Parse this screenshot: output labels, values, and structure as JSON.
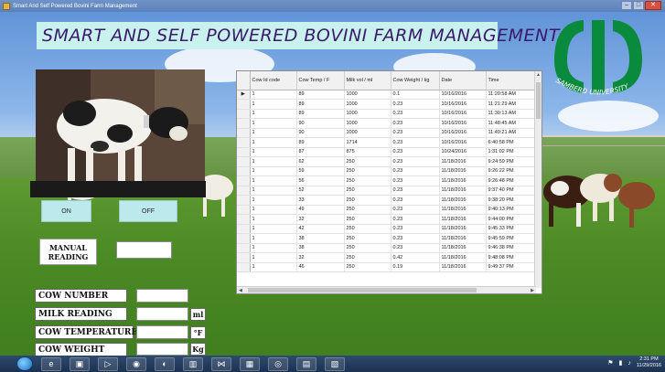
{
  "window": {
    "title": "Smart And Self Powered Bovini Farm Management",
    "minimize": "–",
    "maximize": "□",
    "close": "✕"
  },
  "heading": "SMART AND SELF POWERED BOVINI FARM MANAGEMENT",
  "logo": {
    "text": "SAMBERD UNIVERSITY",
    "icon": "university-logo"
  },
  "controls": {
    "on_label": "ON",
    "off_label": "OFF",
    "manual_reading_line1": "MANUAL",
    "manual_reading_line2": "READING",
    "manual_reading_value": ""
  },
  "fields": {
    "cow_number": {
      "label": "COW NUMBER",
      "value": ""
    },
    "milk_reading": {
      "label": "MILK READING",
      "value": "",
      "unit": "ml"
    },
    "cow_temperature": {
      "label": "COW TEMPERATURE",
      "value": "",
      "unit": "°F"
    },
    "cow_weight": {
      "label": "COW WEIGHT",
      "value": "",
      "unit": "Kg"
    }
  },
  "grid": {
    "columns": [
      "Cow Id code",
      "Cow Temp / F",
      "Milk vol / ml",
      "Cow Weight / kg",
      "Date",
      "Time"
    ],
    "rows": [
      [
        "1",
        "89",
        "1000",
        "0.1",
        "10/16/2016",
        "11:20:58 AM"
      ],
      [
        "1",
        "89",
        "1000",
        "0.23",
        "10/16/2016",
        "11:21:29 AM"
      ],
      [
        "1",
        "89",
        "1000",
        "0.23",
        "10/16/2016",
        "11:30:13 AM"
      ],
      [
        "1",
        "90",
        "1000",
        "0.23",
        "10/16/2016",
        "11:48:45 AM"
      ],
      [
        "1",
        "90",
        "1000",
        "0.23",
        "10/16/2016",
        "11:49:21 AM"
      ],
      [
        "1",
        "89",
        "1714",
        "0.23",
        "10/16/2016",
        "6:40:58 PM"
      ],
      [
        "1",
        "87",
        "875",
        "0.23",
        "10/24/2016",
        "1:31:02 PM"
      ],
      [
        "1",
        "62",
        "250",
        "0.23",
        "11/18/2016",
        "9:24:59 PM"
      ],
      [
        "1",
        "59",
        "250",
        "0.23",
        "11/18/2016",
        "9:26:22 PM"
      ],
      [
        "1",
        "56",
        "250",
        "0.23",
        "11/18/2016",
        "9:26:48 PM"
      ],
      [
        "1",
        "52",
        "250",
        "0.23",
        "11/18/2016",
        "9:37:40 PM"
      ],
      [
        "1",
        "33",
        "250",
        "0.23",
        "11/18/2016",
        "9:38:20 PM"
      ],
      [
        "1",
        "49",
        "250",
        "0.23",
        "11/18/2016",
        "9:40:13 PM"
      ],
      [
        "1",
        "32",
        "250",
        "0.23",
        "11/18/2016",
        "9:44:00 PM"
      ],
      [
        "1",
        "42",
        "250",
        "0.23",
        "11/18/2016",
        "9:45:33 PM"
      ],
      [
        "1",
        "38",
        "250",
        "0.23",
        "11/18/2016",
        "9:45:59 PM"
      ],
      [
        "1",
        "38",
        "250",
        "0.23",
        "11/18/2016",
        "9:46:38 PM"
      ],
      [
        "1",
        "32",
        "250",
        "0.42",
        "11/18/2016",
        "9:48:08 PM"
      ],
      [
        "1",
        "46",
        "250",
        "0.19",
        "11/18/2016",
        "9:49:37 PM"
      ]
    ],
    "current_row_marker": "▶"
  },
  "taskbar": {
    "items": [
      "e",
      "▣",
      "▷",
      "◉",
      "◐",
      "▥",
      "⋈",
      "▦",
      "◎",
      "▤",
      "▧"
    ],
    "clock_time": "2:31 PM",
    "clock_date": "11/29/2016"
  }
}
